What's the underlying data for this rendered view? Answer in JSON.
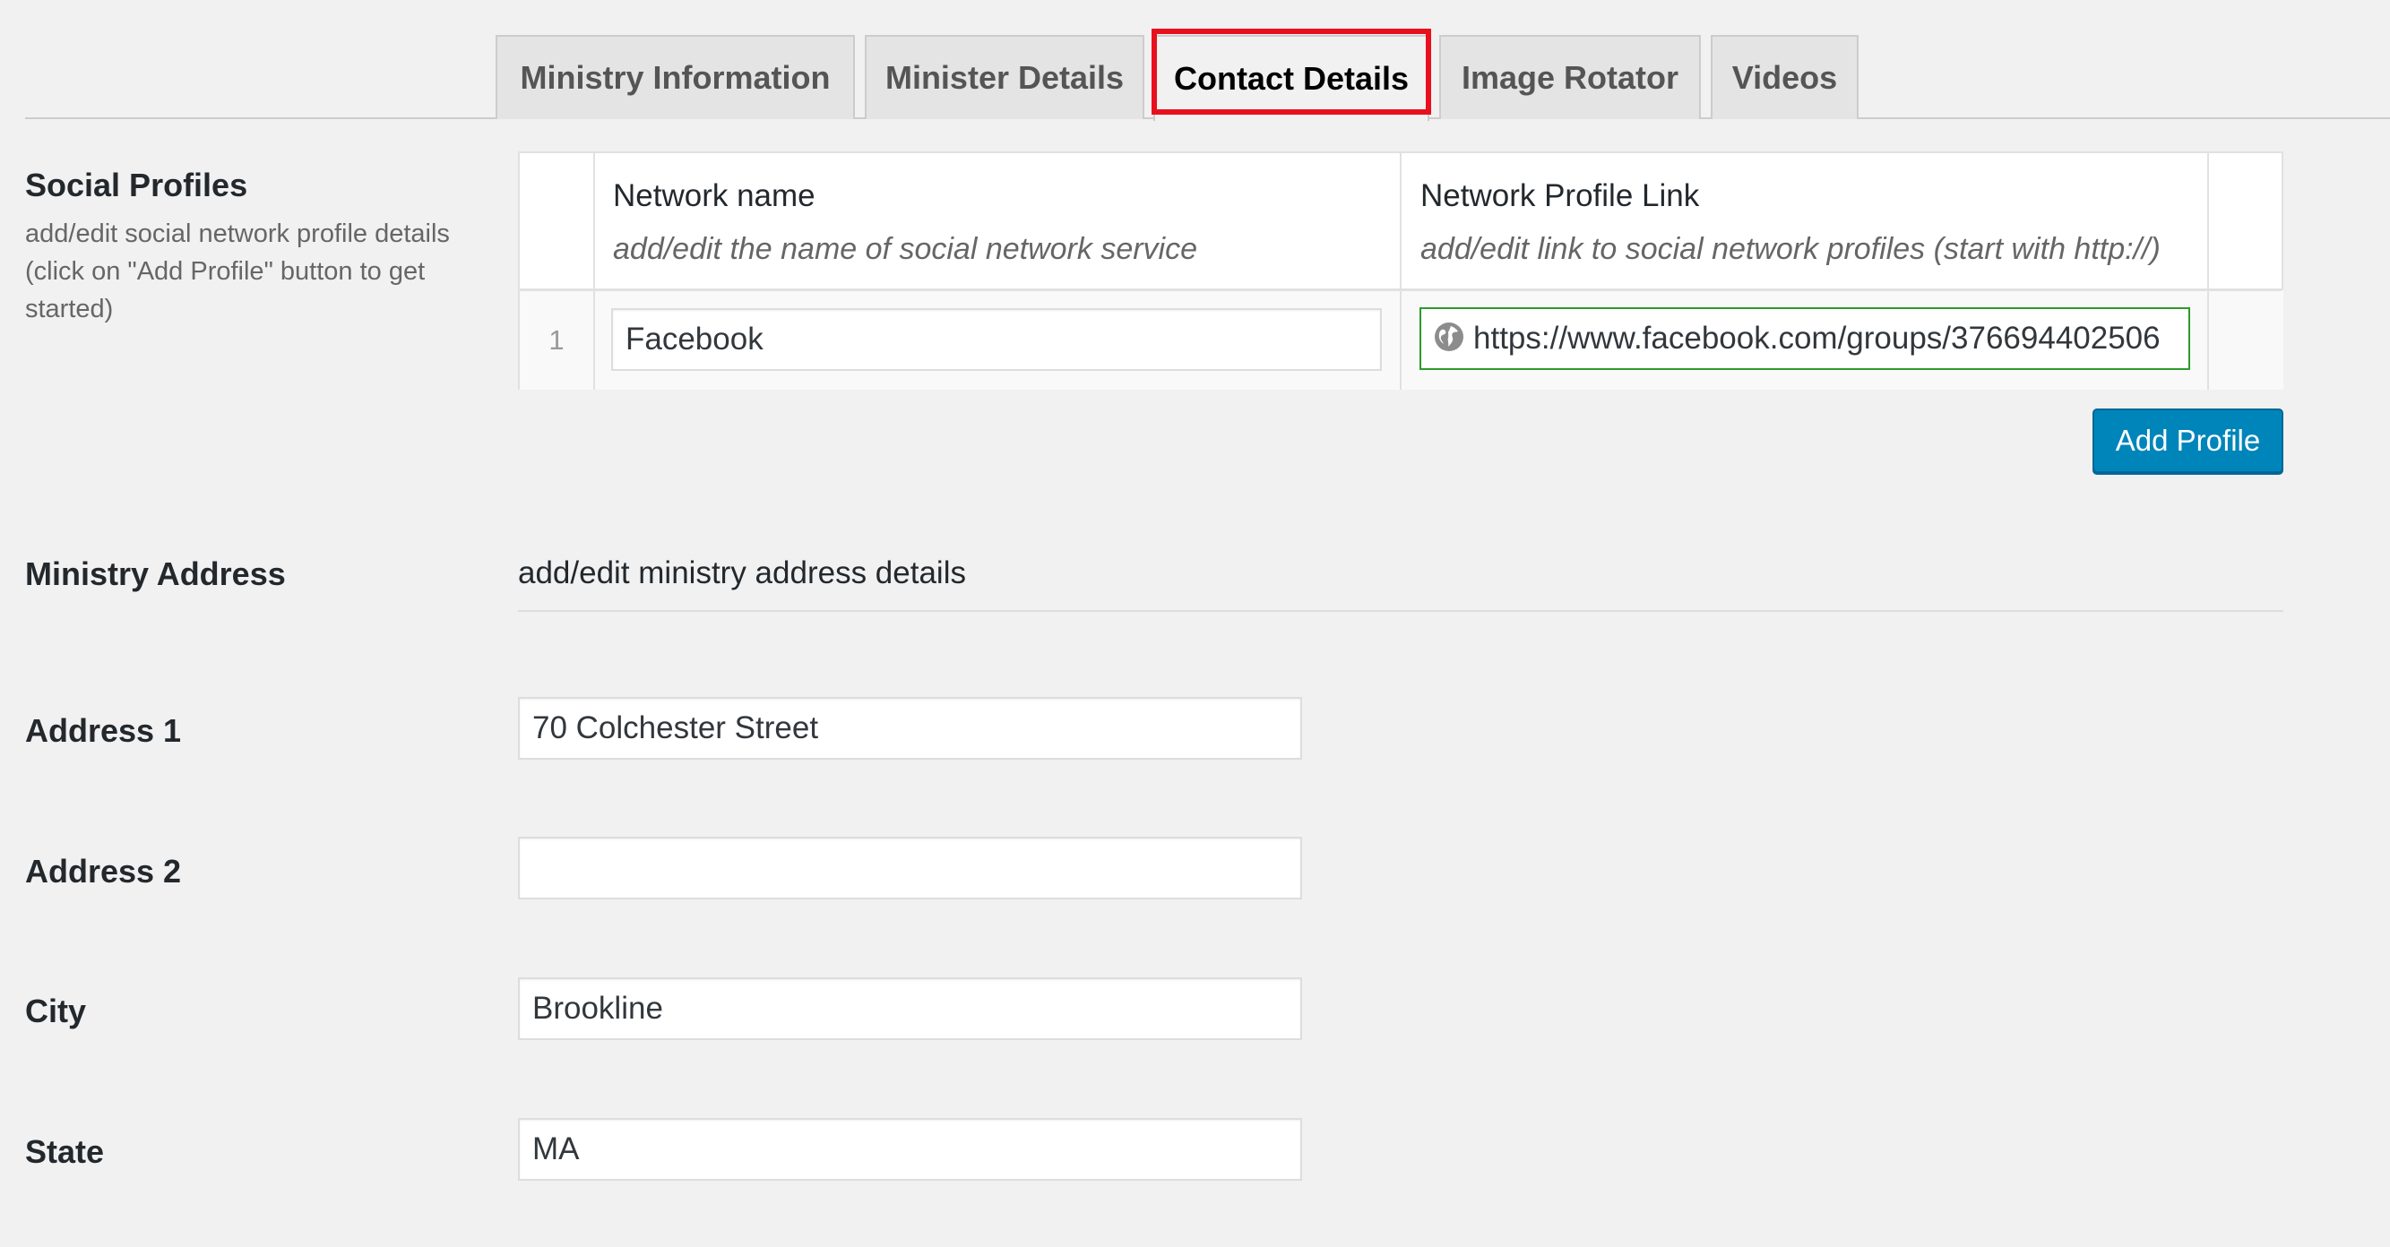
{
  "tabs": [
    {
      "label": "Ministry Information",
      "active": false
    },
    {
      "label": "Minister Details",
      "active": false
    },
    {
      "label": "Contact Details",
      "active": true
    },
    {
      "label": "Image Rotator",
      "active": false
    },
    {
      "label": "Videos",
      "active": false
    }
  ],
  "social_profiles": {
    "label": "Social Profiles",
    "description": "add/edit social network profile details (click on \"Add Profile\" button to get started)",
    "columns": [
      {
        "title": "Network name",
        "description": "add/edit the name of social network service"
      },
      {
        "title": "Network Profile Link",
        "description": "add/edit link to social network profiles (start with http://)"
      }
    ],
    "rows": [
      {
        "number": "1",
        "network_name": "Facebook",
        "link": "https://www.facebook.com/groups/376694402506"
      }
    ],
    "add_button_label": "Add Profile"
  },
  "ministry_address": {
    "label": "Ministry Address",
    "description": "add/edit ministry address details",
    "fields": [
      {
        "label": "Address 1",
        "value": "70 Colchester Street"
      },
      {
        "label": "Address 2",
        "value": ""
      },
      {
        "label": "City",
        "value": "Brookline"
      },
      {
        "label": "State",
        "value": "MA"
      }
    ]
  },
  "colors": {
    "primary_button": "#0085ba",
    "highlight_box": "#e8101d",
    "valid_url_border": "#2c9a2c"
  },
  "icons": {
    "url_field": "globe-icon"
  }
}
